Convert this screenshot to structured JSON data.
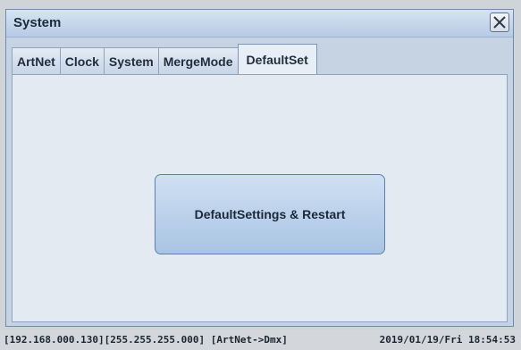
{
  "window": {
    "title": "System",
    "close_icon": "close-icon"
  },
  "tabs": [
    {
      "label": "ArtNet",
      "active": false
    },
    {
      "label": "Clock",
      "active": false
    },
    {
      "label": "System",
      "active": false
    },
    {
      "label": "MergeMode",
      "active": false
    },
    {
      "label": "DefaultSet",
      "active": true
    }
  ],
  "panel": {
    "default_button_label": "DefaultSettings & Restart"
  },
  "statusbar": {
    "network": "[192.168.000.130][255.255.255.000] [ArtNet->Dmx]",
    "datetime": "2019/01/19/Fri  18:54:53"
  },
  "colors": {
    "window_bg": "#c6d3e3",
    "button_bg": "#a9c4e3"
  }
}
